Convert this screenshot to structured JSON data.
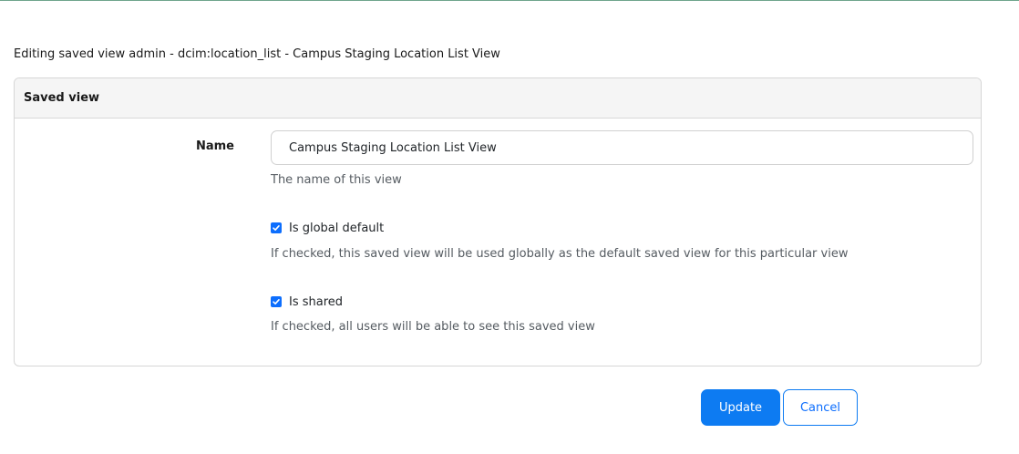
{
  "page": {
    "title": "Editing saved view admin - dcim:location_list - Campus Staging Location List View"
  },
  "panel": {
    "heading": "Saved view"
  },
  "form": {
    "name": {
      "label": "Name",
      "value": "Campus Staging Location List View",
      "help": "The name of this view"
    },
    "is_global_default": {
      "label": "Is global default",
      "checked": true,
      "help": "If checked, this saved view will be used globally as the default saved view for this particular view"
    },
    "is_shared": {
      "label": "Is shared",
      "checked": true,
      "help": "If checked, all users will be able to see this saved view"
    }
  },
  "actions": {
    "update_label": "Update",
    "cancel_label": "Cancel"
  },
  "colors": {
    "primary": "#0d7bf2",
    "panel_heading_bg": "#f5f5f5",
    "help_text": "#555b61"
  },
  "icons": {
    "checkbox_checked": "check-icon"
  }
}
